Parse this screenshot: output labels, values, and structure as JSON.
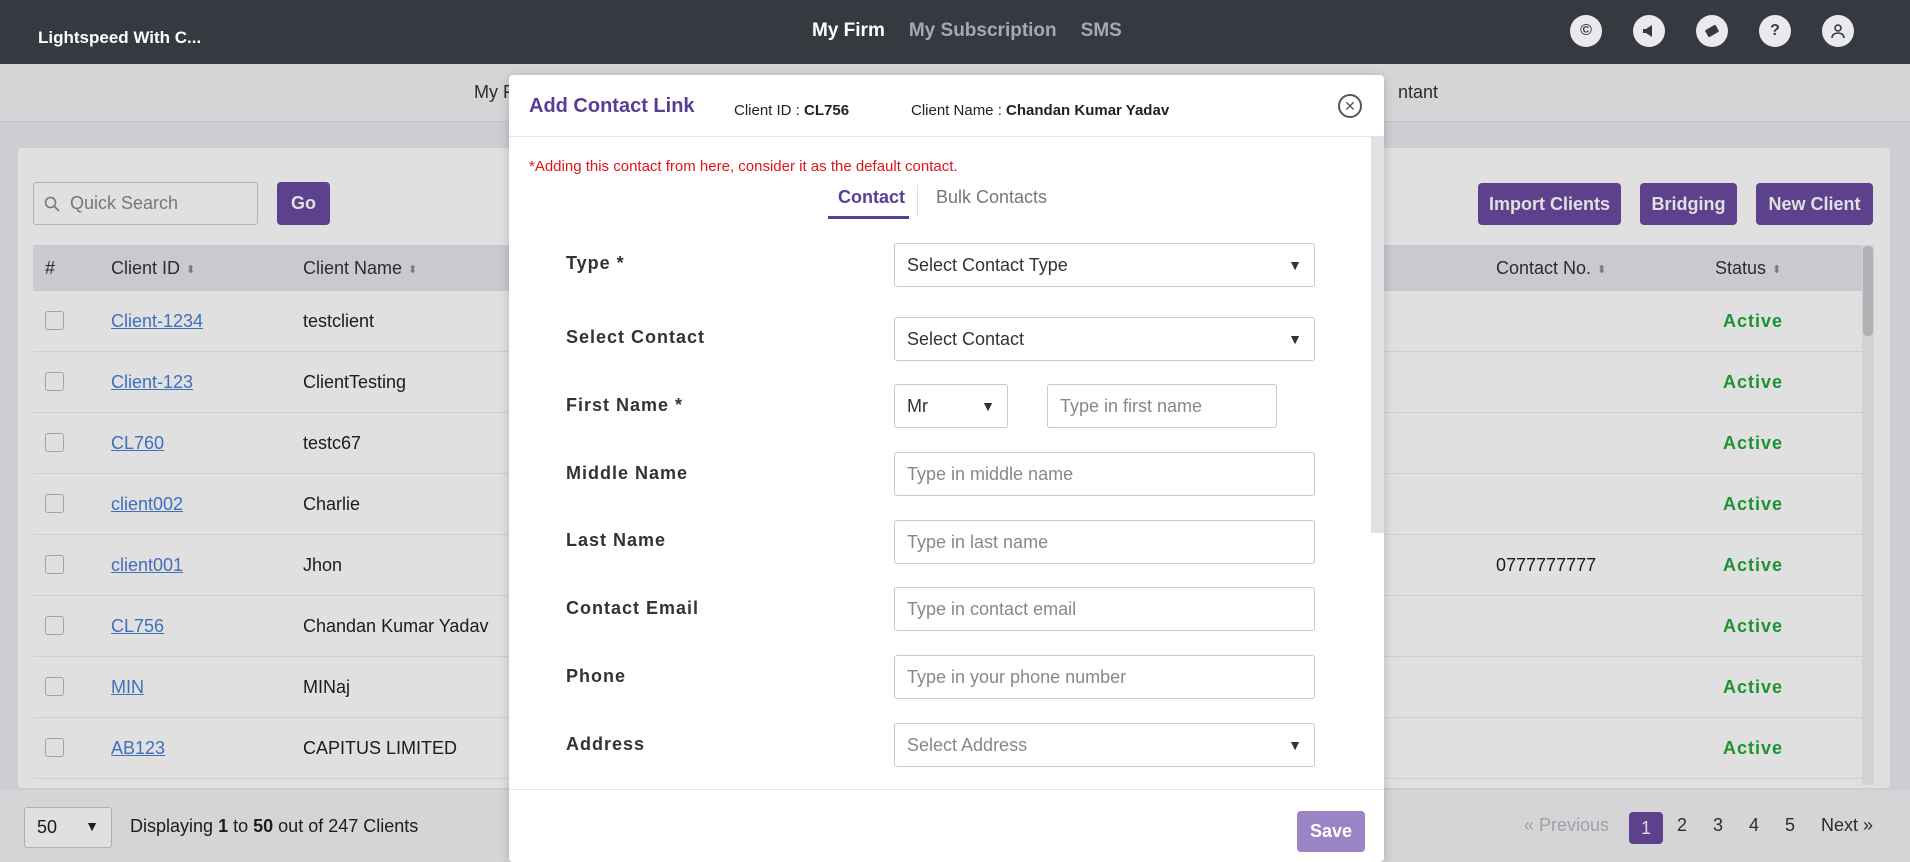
{
  "app": {
    "brand": "Lightspeed With C..."
  },
  "topnav": {
    "items": [
      "My Firm",
      "My Subscription",
      "SMS"
    ],
    "active": "My Firm"
  },
  "topicons": [
    "copyright-icon",
    "megaphone-icon",
    "ticket-icon",
    "help-icon",
    "user-icon"
  ],
  "subnav": {
    "left_partial": "My F",
    "right_partial": "ntant"
  },
  "search": {
    "placeholder": "Quick Search",
    "go_label": "Go"
  },
  "actions": {
    "import": "Import Clients",
    "bridging": "Bridging",
    "new_client": "New Client"
  },
  "table": {
    "headers": {
      "hash": "#",
      "client_id": "Client ID",
      "client_name": "Client Name",
      "contact_no": "Contact No.",
      "status": "Status"
    },
    "rows": [
      {
        "client_id": "Client-1234",
        "client_name": "testclient",
        "contact_no": "",
        "status": "Active"
      },
      {
        "client_id": "Client-123",
        "client_name": "ClientTesting",
        "contact_no": "",
        "status": "Active"
      },
      {
        "client_id": "CL760",
        "client_name": "testc67",
        "contact_no": "",
        "status": "Active"
      },
      {
        "client_id": "client002",
        "client_name": "Charlie",
        "contact_no": "",
        "status": "Active"
      },
      {
        "client_id": "client001",
        "client_name": "Jhon",
        "contact_no": "0777777777",
        "status": "Active"
      },
      {
        "client_id": "CL756",
        "client_name": "Chandan Kumar Yadav",
        "contact_no": "",
        "status": "Active"
      },
      {
        "client_id": "MIN",
        "client_name": "MINaj",
        "contact_no": "",
        "status": "Active"
      },
      {
        "client_id": "AB123",
        "client_name": "CAPITUS LIMITED",
        "contact_no": "",
        "status": "Active"
      }
    ]
  },
  "footer": {
    "page_size": "50",
    "display_prefix": "Displaying",
    "from": "1",
    "to_word": "to",
    "to": "50",
    "suffix": "out of 247 Clients",
    "prev": "« Previous",
    "pages": [
      "1",
      "2",
      "3",
      "4",
      "5"
    ],
    "current_page": "1",
    "next": "Next »"
  },
  "modal": {
    "title": "Add Contact Link",
    "client_id_label": "Client ID :",
    "client_id": "CL756",
    "client_name_label": "Client Name :",
    "client_name": "Chandan Kumar Yadav",
    "note": "*Adding this contact from here, consider it as the default contact.",
    "tabs": [
      "Contact",
      "Bulk Contacts"
    ],
    "fields": {
      "type_label": "Type *",
      "type_value": "Select Contact Type",
      "select_contact_label": "Select Contact",
      "select_contact_value": "Select Contact",
      "first_name_label": "First Name *",
      "title_value": "Mr",
      "first_name_placeholder": "Type in first name",
      "middle_name_label": "Middle Name",
      "middle_name_placeholder": "Type in middle name",
      "last_name_label": "Last Name",
      "last_name_placeholder": "Type in last name",
      "email_label": "Contact Email",
      "email_placeholder": "Type in contact email",
      "phone_label": "Phone",
      "phone_placeholder": "Type in your phone number",
      "address_label": "Address",
      "address_value": "Select Address"
    },
    "save_label": "Save"
  },
  "colors": {
    "accent": "#6a4aa0",
    "topbar": "#343a40",
    "active_status": "#22a73a",
    "note": "#e0141a"
  }
}
